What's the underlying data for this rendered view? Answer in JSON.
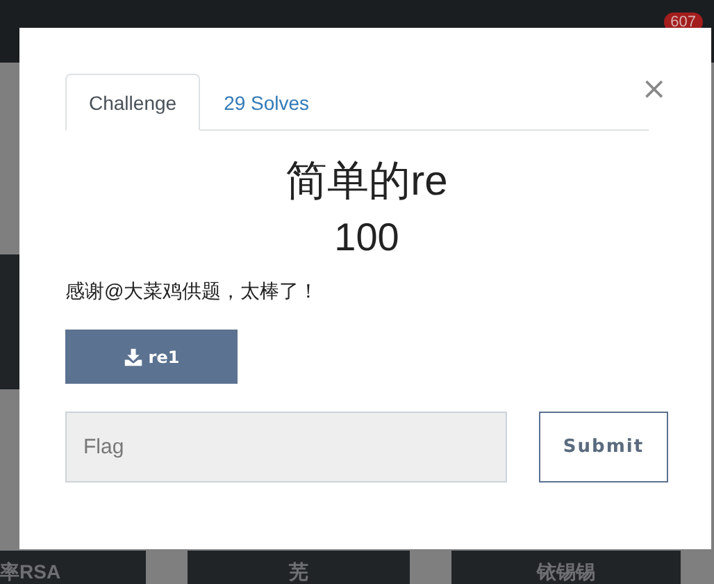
{
  "navbar": {
    "badge": "607"
  },
  "background": {
    "tiles": [
      "率RSA",
      "芜",
      "铱锡锡"
    ]
  },
  "modal": {
    "tabs": [
      {
        "label": "Challenge",
        "selected": true
      },
      {
        "label": "29 Solves",
        "selected": false
      }
    ],
    "close": "×",
    "title": "简单的re",
    "value": "100",
    "description": "感谢@大菜鸡供题，太棒了！",
    "files": [
      {
        "label": "re1"
      }
    ],
    "flag": {
      "placeholder": "Flag"
    },
    "submit": "Submit"
  }
}
